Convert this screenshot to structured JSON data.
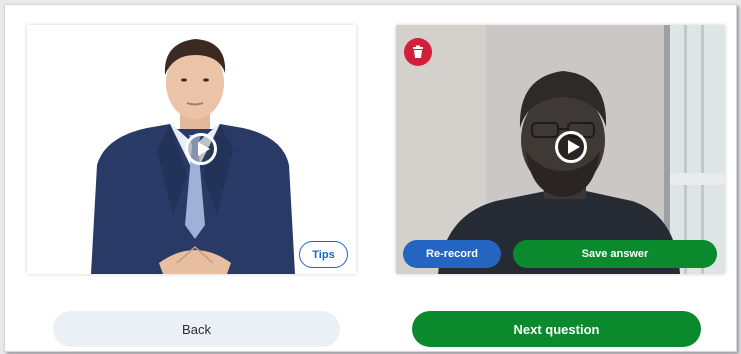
{
  "prompt_video": {
    "tips_label": "Tips",
    "play_icon": "play-icon"
  },
  "answer_video": {
    "delete_icon": "trash-icon",
    "play_icon": "play-icon",
    "rerecord_label": "Re-record",
    "save_label": "Save answer"
  },
  "navigation": {
    "back_label": "Back",
    "next_label": "Next question"
  },
  "colors": {
    "primary_blue": "#2365c1",
    "success_green": "#0b8a2d",
    "danger_red": "#d21f3a",
    "back_bg": "#eaf0f6"
  }
}
